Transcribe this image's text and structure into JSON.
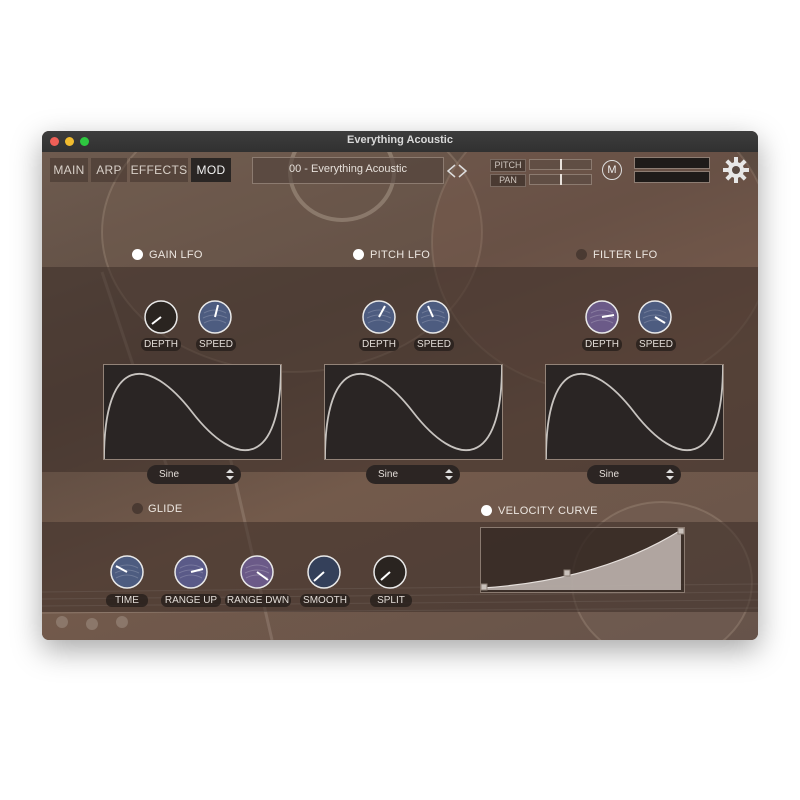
{
  "window": {
    "title": "Everything Acoustic"
  },
  "tabs": [
    {
      "label": "MAIN",
      "active": false
    },
    {
      "label": "ARP",
      "active": false
    },
    {
      "label": "EFFECTS",
      "active": false
    },
    {
      "label": "MOD",
      "active": true
    }
  ],
  "preset": {
    "name": "00 - Everything Acoustic"
  },
  "header": {
    "pitch_label": "PITCH",
    "pan_label": "PAN",
    "m_label": "M",
    "pitch_value": 0.5,
    "pan_value": 0.5
  },
  "lfos": [
    {
      "title": "GAIN LFO",
      "enabled": true,
      "depth_label": "DEPTH",
      "speed_label": "SPEED",
      "shape": "Sine"
    },
    {
      "title": "PITCH LFO",
      "enabled": true,
      "depth_label": "DEPTH",
      "speed_label": "SPEED",
      "shape": "Sine"
    },
    {
      "title": "FILTER LFO",
      "enabled": false,
      "depth_label": "DEPTH",
      "speed_label": "SPEED",
      "shape": "Sine"
    }
  ],
  "glide": {
    "title": "GLIDE",
    "enabled": false,
    "knobs": [
      {
        "label": "TIME"
      },
      {
        "label": "RANGE UP"
      },
      {
        "label": "RANGE DWN"
      },
      {
        "label": "SMOOTH"
      },
      {
        "label": "SPLIT"
      }
    ]
  },
  "velocity": {
    "title": "VELOCITY CURVE",
    "enabled": true
  },
  "colors": {
    "led_on": "#ffffff",
    "led_off": "#4a3a32",
    "accent_blue": "#4d5c80",
    "accent_purple": "#6b5a88"
  },
  "icons": {
    "settings": "gear-icon",
    "prev": "chevron-left-icon",
    "next": "chevron-right-icon"
  }
}
